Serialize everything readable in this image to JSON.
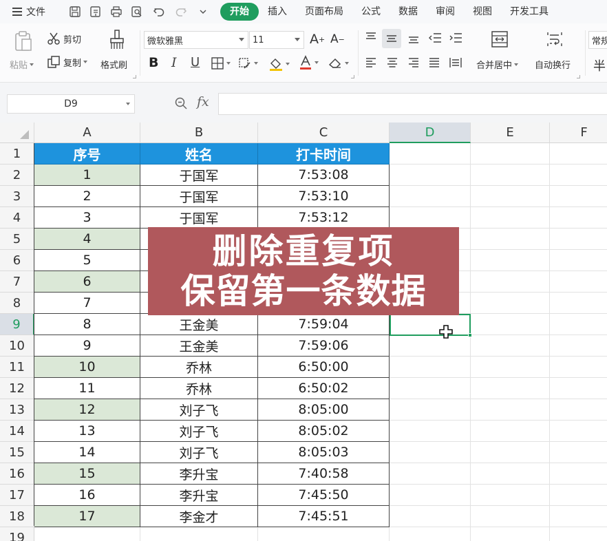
{
  "menubar": {
    "file_label": "文件",
    "tabs": [
      "开始",
      "插入",
      "页面布局",
      "公式",
      "数据",
      "审阅",
      "视图",
      "开发工具"
    ],
    "active_tab": "开始"
  },
  "ribbon": {
    "paste_label": "粘贴",
    "cut_label": "剪切",
    "copy_label": "复制",
    "format_painter_label": "格式刷",
    "font_name": "微软雅黑",
    "font_size": "11",
    "merge_label": "合并居中",
    "wrap_label": "自动换行",
    "number_format_partial": "常规",
    "currency_partial": "半"
  },
  "formula_bar": {
    "name_box": "D9",
    "fx_label": "fx",
    "formula": ""
  },
  "sheet": {
    "columns": [
      "A",
      "B",
      "C",
      "D",
      "E",
      "F"
    ],
    "selected_column": "D",
    "selected_row": "9",
    "row_numbers": [
      "1",
      "2",
      "3",
      "4",
      "5",
      "6",
      "7",
      "8",
      "9",
      "10",
      "11",
      "12",
      "13",
      "14",
      "15",
      "16",
      "17",
      "18",
      "19"
    ],
    "headers": [
      "序号",
      "姓名",
      "打卡时间"
    ],
    "rows": [
      {
        "a": "1",
        "b": "于国军",
        "c": "7:53:08",
        "dup": true
      },
      {
        "a": "2",
        "b": "于国军",
        "c": "7:53:10",
        "dup": false
      },
      {
        "a": "3",
        "b": "于国军",
        "c": "7:53:12",
        "dup": false
      },
      {
        "a": "4",
        "b": "",
        "c": "",
        "dup": true
      },
      {
        "a": "5",
        "b": "",
        "c": "",
        "dup": false
      },
      {
        "a": "6",
        "b": "",
        "c": "",
        "dup": true
      },
      {
        "a": "7",
        "b": "",
        "c": "",
        "dup": false
      },
      {
        "a": "8",
        "b": "王金美",
        "c": "7:59:04",
        "dup": false
      },
      {
        "a": "9",
        "b": "王金美",
        "c": "7:59:06",
        "dup": false
      },
      {
        "a": "10",
        "b": "乔林",
        "c": "6:50:00",
        "dup": true
      },
      {
        "a": "11",
        "b": "乔林",
        "c": "6:50:02",
        "dup": false
      },
      {
        "a": "12",
        "b": "刘子飞",
        "c": "8:05:00",
        "dup": true
      },
      {
        "a": "13",
        "b": "刘子飞",
        "c": "8:05:02",
        "dup": false
      },
      {
        "a": "14",
        "b": "刘子飞",
        "c": "8:05:03",
        "dup": false
      },
      {
        "a": "15",
        "b": "李升宝",
        "c": "7:40:58",
        "dup": true
      },
      {
        "a": "16",
        "b": "李升宝",
        "c": "7:45:50",
        "dup": false
      },
      {
        "a": "17",
        "b": "李金才",
        "c": "7:45:51",
        "dup": true
      }
    ]
  },
  "overlay": {
    "line1": "删除重复项",
    "line2": "保留第一条数据"
  },
  "colors": {
    "accent_green": "#1f9d5e",
    "header_blue": "#1e93dd",
    "duplicate_fill": "#dbe8d7",
    "banner_red": "#b0585c"
  }
}
